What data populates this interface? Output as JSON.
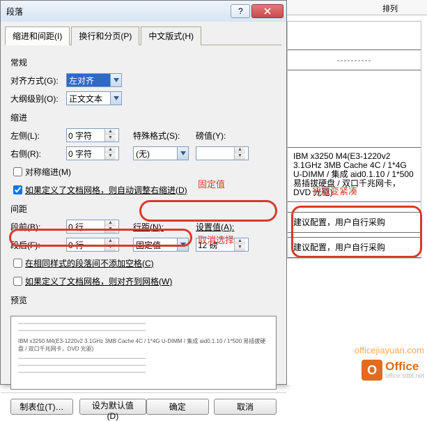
{
  "dialog": {
    "title": "段落",
    "tabs": [
      "缩进和间距(I)",
      "换行和分页(P)",
      "中文版式(H)"
    ],
    "sections": {
      "general": {
        "title": "常规",
        "align_label": "对齐方式(G):",
        "align_value": "左对齐",
        "outline_label": "大纲级别(O):",
        "outline_value": "正文文本"
      },
      "indent": {
        "title": "缩进",
        "left_label": "左侧(L):",
        "left_value": "0 字符",
        "right_label": "右侧(R):",
        "right_value": "0 字符",
        "special_label": "特殊格式(S):",
        "special_value": "(无)",
        "bylabel": "磅值(Y):",
        "byvalue": "",
        "mirror_check": "对称缩进(M)",
        "grid_check": "如果定义了文档网格，则自动调整右缩进(D)"
      },
      "spacing": {
        "title": "间距",
        "before_label": "段前(B):",
        "before_value": "0 行",
        "after_label": "段后(F):",
        "after_value": "0 行",
        "line_label": "行距(N):",
        "line_value": "固定值",
        "at_label": "设置值(A):",
        "at_value": "12 磅",
        "nostyle_check": "在相同样式的段落间不添加空格(C)",
        "snap_check": "如果定义了文档网格，则对齐到网格(W)"
      },
      "preview": {
        "title": "预览",
        "sample": "IBM x3250 M4(E3-1220v2 3.1GHz 3MB Cache 4C / 1*4G U-DIMM / 集成 aid0.1.10 / 1*500 易插拔硬盘 / 双口千兆网卡，DVD 光驱)"
      }
    },
    "buttons": {
      "tabs": "制表位(T)…",
      "default": "设为默认值(D)",
      "ok": "确定",
      "cancel": "取消"
    }
  },
  "annotations": {
    "fixed": "固定值",
    "uncheck": "取消选择",
    "tight": "行距变紧凑"
  },
  "doc": {
    "ruler_label": "排列",
    "dash_row": "----------",
    "para1": "IBM x3250 M4(E3-1220v2 3.1GHz 3MB Cache 4C / 1*4G U-DIMM / 集成 aid0.1.10 / 1*500 易插拔硬盘 / 双口千兆网卡，DVD 光驱)",
    "para2": "建议配置，用户自行采购",
    "para3": "建议配置，用户自行采购"
  },
  "watermark": {
    "url": "officejiayuan.com",
    "brand": "Office",
    "sub": "office.sdbt.net"
  }
}
